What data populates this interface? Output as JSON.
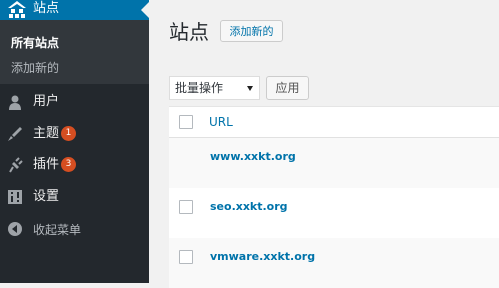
{
  "sidebar": {
    "sites_label": "站点",
    "submenu": {
      "all_sites": "所有站点",
      "add_new": "添加新的"
    },
    "items": [
      {
        "label": "用户",
        "icon": "user-icon"
      },
      {
        "label": "主题",
        "icon": "brush-icon",
        "badge": "1"
      },
      {
        "label": "插件",
        "icon": "plugin-icon",
        "badge": "3"
      },
      {
        "label": "设置",
        "icon": "settings-icon"
      }
    ],
    "collapse": {
      "label": "收起菜单",
      "icon": "collapse-icon"
    }
  },
  "main": {
    "title": "站点",
    "add_new_button": "添加新的",
    "bulk_actions": {
      "selected": "批量操作"
    },
    "apply_button": "应用",
    "table": {
      "header_url": "URL",
      "rows": [
        {
          "url": "www.xxkt.org",
          "has_checkbox": false
        },
        {
          "url": "seo.xxkt.org",
          "has_checkbox": true
        },
        {
          "url": "vmware.xxkt.org",
          "has_checkbox": true
        }
      ]
    }
  },
  "colors": {
    "sidebar_bg": "#23282d",
    "active_menu_bg": "#0073aa",
    "link": "#0073aa",
    "badge": "#d54e21"
  }
}
